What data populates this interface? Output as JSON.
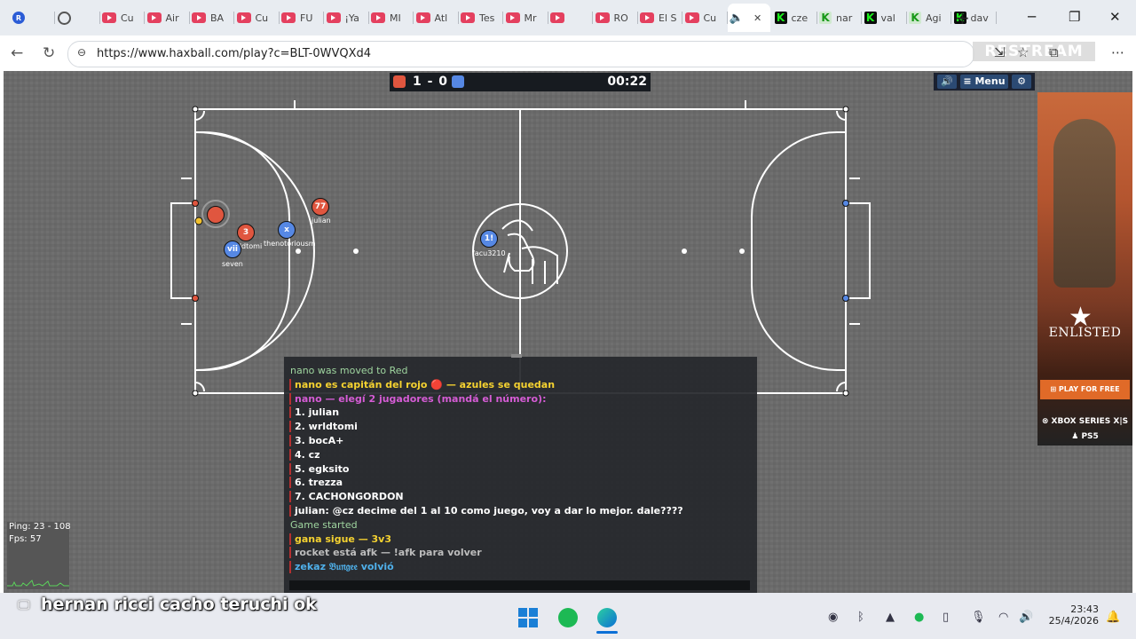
{
  "browser": {
    "tabs": [
      {
        "icon": "record-icon",
        "label": ""
      },
      {
        "icon": "circle-icon",
        "label": ""
      },
      {
        "icon": "youtube-icon",
        "label": "Cu"
      },
      {
        "icon": "youtube-icon",
        "label": "Air"
      },
      {
        "icon": "youtube-icon",
        "label": "BA"
      },
      {
        "icon": "youtube-icon",
        "label": "Cu"
      },
      {
        "icon": "youtube-icon",
        "label": "FU"
      },
      {
        "icon": "youtube-icon",
        "label": "¡Ya"
      },
      {
        "icon": "youtube-icon",
        "label": "MI"
      },
      {
        "icon": "youtube-icon",
        "label": "Atl"
      },
      {
        "icon": "youtube-icon",
        "label": "Tes"
      },
      {
        "icon": "youtube-icon",
        "label": "Mr"
      },
      {
        "icon": "youtube-icon",
        "label": ""
      },
      {
        "icon": "youtube-icon",
        "label": "RO"
      },
      {
        "icon": "youtube-icon",
        "label": "El S"
      },
      {
        "icon": "youtube-icon",
        "label": "Cu"
      },
      {
        "icon": "speaker-icon",
        "label": "",
        "active": true
      },
      {
        "icon": "kick-icon",
        "label": "cze"
      },
      {
        "icon": "kick-icon",
        "label": "nar"
      },
      {
        "icon": "kick-icon",
        "label": "val"
      },
      {
        "icon": "kick-icon",
        "label": "Agi"
      },
      {
        "icon": "kick-icon",
        "label": "dav"
      }
    ],
    "url": "https://www.haxball.com/play?c=BLT-0WVQXd4",
    "watermark": "RESTREAM"
  },
  "game": {
    "score": "1 - 0",
    "time": "00:22",
    "menu_label": "Menu",
    "team_colors": {
      "red": "#e0563f",
      "blue": "#5688e4"
    },
    "players": [
      {
        "number": "",
        "name": "",
        "team": "red"
      },
      {
        "number": "3",
        "name": "wrldtomi",
        "team": "red"
      },
      {
        "number": "77",
        "name": "julian",
        "team": "red"
      },
      {
        "number": "vii",
        "name": "seven",
        "team": "blue"
      },
      {
        "number": "x",
        "name": "thenotoriousm",
        "team": "blue"
      },
      {
        "number": "1!",
        "name": "facu3210",
        "team": "blue"
      }
    ]
  },
  "chat": {
    "lines": [
      {
        "text": "nano was moved to Red",
        "color": "#9fd59f",
        "bar": false,
        "bold": false
      },
      {
        "text": "nano es capitán del rojo 🔴 — azules se quedan",
        "color": "#f5d230",
        "bar": true,
        "bold": true
      },
      {
        "text": "nano — elegí 2 jugadores (mandá el número):",
        "color": "#d55cd5",
        "bar": true,
        "bold": true
      },
      {
        "text": "1.  julian",
        "color": "#ffffff",
        "bar": true,
        "bold": true
      },
      {
        "text": "2.  wrldtomi",
        "color": "#ffffff",
        "bar": true,
        "bold": true
      },
      {
        "text": "3.  bocA+",
        "color": "#ffffff",
        "bar": true,
        "bold": true
      },
      {
        "text": "4.  cz",
        "color": "#ffffff",
        "bar": true,
        "bold": true
      },
      {
        "text": "5.  egksito",
        "color": "#ffffff",
        "bar": true,
        "bold": true
      },
      {
        "text": "6.  trezza",
        "color": "#ffffff",
        "bar": true,
        "bold": true
      },
      {
        "text": "7.  CACHONGORDON",
        "color": "#ffffff",
        "bar": true,
        "bold": true
      },
      {
        "text": "julian: @cz decime del 1 al 10 como juego, voy a dar lo mejor. dale????",
        "color": "#ffffff",
        "bar": true,
        "bold": true
      },
      {
        "text": "Game started",
        "color": "#9fd59f",
        "bar": false,
        "bold": false
      },
      {
        "text": "gana sigue  —  3v3",
        "color": "#f5d230",
        "bar": true,
        "bold": true
      },
      {
        "text": "rocket está afk — !afk para volver",
        "color": "#bdbdbd",
        "bar": true,
        "bold": true
      },
      {
        "text": "zekaz 𝔅𝔲𝔫𝔤𝔢𝔢 volvió",
        "color": "#4fb0ea",
        "bar": true,
        "bold": true
      }
    ]
  },
  "stats": {
    "ping": "Ping: 23 - 108",
    "fps": "Fps: 57"
  },
  "ad": {
    "title": "ENLISTED",
    "button": "PLAY FOR FREE",
    "platform1": "XBOX SERIES X|S",
    "platform2": "PS5"
  },
  "overlay_caption": "hernan ricci cacho teruchi ok",
  "taskbar": {
    "time": "23:43",
    "date": "25/4/2026",
    "apps": [
      "windows-start-icon",
      "spotify-icon",
      "edge-icon"
    ]
  }
}
